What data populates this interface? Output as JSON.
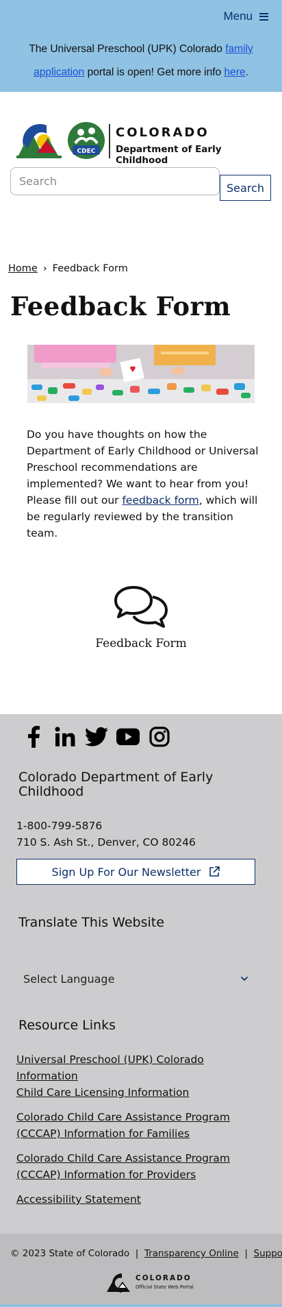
{
  "banner": {
    "menu_label": "Menu",
    "alert_pre": "The Universal Preschool (UPK) Colorado ",
    "alert_link1": "family application",
    "alert_mid": " portal is open! Get more info ",
    "alert_link2": "here",
    "alert_post": "."
  },
  "logo": {
    "badge": "CDEC",
    "title_line1": "COLORADO",
    "title_line2": "Department of Early Childhood"
  },
  "search": {
    "placeholder": "Search",
    "button_label": "Search"
  },
  "breadcrumb": {
    "home": "Home",
    "separator": "›",
    "current": "Feedback Form"
  },
  "page": {
    "title": "Feedback Form",
    "body_pre": "Do you have thoughts on how the Department of Early Childhood or Universal Preschool recommendations are implemented? We want to hear from you! Please fill out our ",
    "body_link": "feedback form",
    "body_post": ", which will be regularly reviewed by the transition team.",
    "card_label": "Feedback Form"
  },
  "footer": {
    "social": [
      "facebook-icon",
      "linkedin-icon",
      "twitter-icon",
      "youtube-icon",
      "instagram-icon"
    ],
    "org_name": "Colorado Department of Early Childhood",
    "phone": "1-800-799-5876",
    "address": "710 S. Ash St., Denver, CO 80246",
    "newsletter_label": "Sign Up For Our Newsletter",
    "translate_heading": "Translate This Website",
    "language_select": "Select Language",
    "resources_heading": "Resource Links",
    "resource_links": [
      "Universal Preschool (UPK) Colorado Information",
      "Child Care Licensing Information",
      "Colorado Child Care Assistance Program (CCCAP) Information for Families",
      "Colorado Child Care Assistance Program (CCCAP) Information for Providers",
      "Accessibility Statement"
    ]
  },
  "bottom": {
    "copyright": "© 2023 State of Colorado",
    "sep": "|",
    "link_transparency": "Transparency Online",
    "link_support": "Support",
    "portal_title": "COLORADO",
    "portal_subtitle": "Official State Web Portal"
  },
  "colors": {
    "banner_bg": "#8fc2e3",
    "brand_navy": "#0b2f6b",
    "footer_bg": "#cdcdcf",
    "bottom_bg": "#bdbdbf"
  }
}
